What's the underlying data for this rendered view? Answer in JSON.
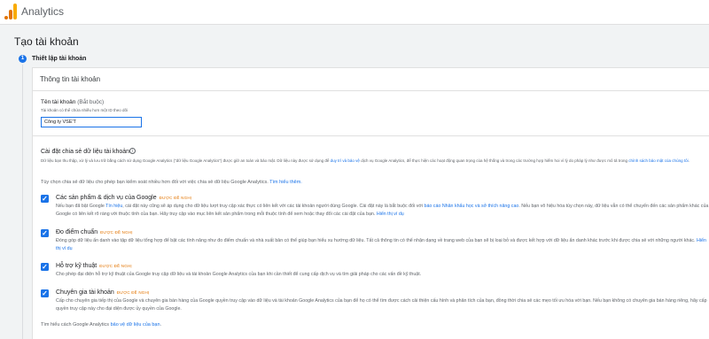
{
  "app": {
    "title": "Analytics"
  },
  "page": {
    "title": "Tạo tài khoản"
  },
  "step": {
    "number": "1",
    "label": "Thiết lập tài khoản"
  },
  "card": {
    "header": "Thông tin tài khoản",
    "account_name_label": "Tên tài khoản",
    "account_name_optional": "(Bắt buộc)",
    "account_name_help": "Tài khoản có thể chứa nhiều hơn một ID theo dõi",
    "account_name_value": "Công ty VSE'T"
  },
  "sharing": {
    "title": "Cài đặt chia sẻ dữ liệu tài khoản",
    "info_icon": "info-icon",
    "desc_part1": "Dữ liệu bạn thu thập, xử lý và lưu trữ bằng cách sử dụng Google Analytics (\"dữ liệu Google Analytics\") được giữ an toàn và bảo mật. Dữ liệu này được sử dụng để ",
    "desc_link1": "duy trì và bảo vệ",
    "desc_part2": " dịch vụ Google Analytics, để thực hiện các hoạt động quan trọng của hệ thống và trong các trường hợp hiếm hoi vì lý do pháp lý như được mô tả trong ",
    "desc_link2": "chính sách bảo mật của chúng tôi",
    "desc_part3": ".",
    "intro": "Tùy chọn chia sẻ dữ liệu cho phép bạn kiểm soát nhiều hơn đối với việc chia sẻ dữ liệu Google Analytics. ",
    "intro_link": "Tìm hiểu thêm.",
    "recommended": "ĐƯỢC ĐỀ NGHỊ",
    "options": [
      {
        "title": "Các sản phẩm & dịch vụ của Google",
        "desc_part1": "Nếu bạn đã bật Google ",
        "desc_link1": "Tín hiệu",
        "desc_part2": ", cài đặt này cũng sẽ áp dụng cho dữ liệu lượt truy cập xác thực có liên kết với các tài khoản người dùng Google. Cài đặt này là bắt buộc đối với ",
        "desc_link2": "báo cáo Nhân khẩu học và sở thích nâng cao",
        "desc_part3": ". Nếu bạn vô hiệu hóa tùy chọn này, dữ liệu vẫn có thể chuyển đến các sản phẩm khác của Google có liên kết rõ ràng với thuộc tính của bạn. Hãy truy cập vào mục liên kết sản phẩm trong mỗi thuộc tính để xem hoặc thay đổi các cài đặt của bạn. ",
        "desc_link3": "Hiển thị ví dụ"
      },
      {
        "title": "Đo điểm chuẩn",
        "desc_part1": "Đóng góp dữ liệu ẩn danh vào tập dữ liệu tổng hợp để bật các tính năng như đo điểm chuẩn và nhà xuất bản có thể giúp bạn hiểu xu hướng dữ liệu. Tất cả thông tin có thể nhận dạng về trang web của bạn sẽ bị loại bỏ và được kết hợp với dữ liệu ẩn danh khác trước khi được chia sẻ với những người khác. ",
        "desc_link1": "Hiển thị ví dụ"
      },
      {
        "title": "Hỗ trợ kỹ thuật",
        "desc_part1": "Cho phép đại diện hỗ trợ kỹ thuật của Google truy cập dữ liệu và tài khoản Google Analytics của bạn khi cần thiết để cung cấp dịch vụ và tìm giải pháp cho các vấn đề kỹ thuật."
      },
      {
        "title": "Chuyên gia tài khoản",
        "desc_part1": "Cấp cho chuyên gia tiếp thị của Google và chuyên gia bán hàng của Google quyền truy cập vào dữ liệu và tài khoản Google Analytics của bạn để họ có thể tìm được cách cải thiện cấu hình và phân tích của bạn, đồng thời chia sẻ các mẹo tối ưu hóa với bạn. Nếu bạn không có chuyên gia bán hàng riêng, hãy cấp quyền truy cập này cho đại diện được ủy quyền của Google."
      }
    ],
    "footer_part1": "Tìm hiểu cách Google Analytics ",
    "footer_link": "bảo vệ dữ liệu của bạn",
    "footer_part2": "."
  }
}
